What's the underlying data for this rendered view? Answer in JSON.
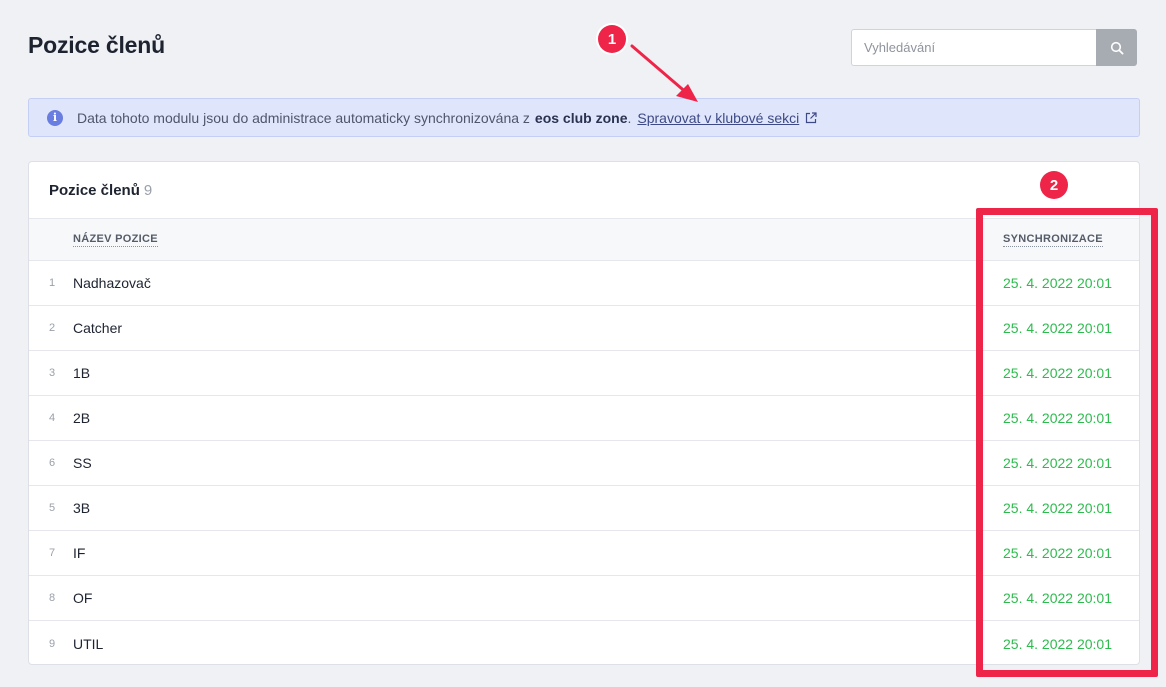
{
  "header": {
    "title": "Pozice členů",
    "search_placeholder": "Vyhledávání"
  },
  "info": {
    "text_before": "Data tohoto modulu jsou do administrace automaticky synchronizována z",
    "brand": "eos club zone",
    "dot": ".",
    "link_label": "Spravovat v klubové sekci"
  },
  "card": {
    "title": "Pozice členů",
    "count": "9",
    "columns": {
      "name": "NÁZEV POZICE",
      "sync": "SYNCHRONIZACE"
    },
    "rows": [
      {
        "num": "1",
        "name": "Nadhazovač",
        "sync": "25. 4. 2022 20:01"
      },
      {
        "num": "2",
        "name": "Catcher",
        "sync": "25. 4. 2022 20:01"
      },
      {
        "num": "3",
        "name": "1B",
        "sync": "25. 4. 2022 20:01"
      },
      {
        "num": "4",
        "name": "2B",
        "sync": "25. 4. 2022 20:01"
      },
      {
        "num": "6",
        "name": "SS",
        "sync": "25. 4. 2022 20:01"
      },
      {
        "num": "5",
        "name": "3B",
        "sync": "25. 4. 2022 20:01"
      },
      {
        "num": "7",
        "name": "IF",
        "sync": "25. 4. 2022 20:01"
      },
      {
        "num": "8",
        "name": "OF",
        "sync": "25. 4. 2022 20:01"
      },
      {
        "num": "9",
        "name": "UTIL",
        "sync": "25. 4. 2022 20:01"
      }
    ]
  },
  "annotations": {
    "badge_1": "1",
    "badge_2": "2",
    "accent_color": "#ef2449"
  },
  "colors": {
    "sync_green": "#2ebb4e",
    "info_bg": "#dfe6fb",
    "page_bg": "#f0f1f5"
  }
}
